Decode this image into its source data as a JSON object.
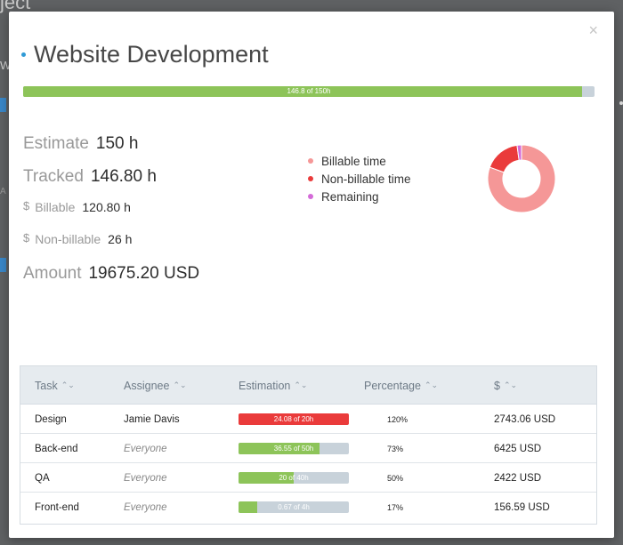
{
  "backdrop": {
    "title_fragment": "ject",
    "letter_w": "W",
    "letter_a": "A"
  },
  "modal": {
    "close_glyph": "×",
    "title": "Website Development",
    "progress": {
      "label": "146.8 of 150h",
      "fraction": 0.9787,
      "fill_color": "#8dc459",
      "track_color": "#c8d2da"
    },
    "stats": {
      "estimate": {
        "label": "Estimate",
        "value": "150 h"
      },
      "tracked": {
        "label": "Tracked",
        "value": "146.80 h"
      },
      "billable": {
        "currency": "$",
        "label": "Billable",
        "value": "120.80 h"
      },
      "non_billable": {
        "currency": "$",
        "label": "Non-billable",
        "value": "26 h"
      },
      "amount": {
        "label": "Amount",
        "value": "19675.20 USD"
      }
    },
    "legend": [
      {
        "label": "Billable time",
        "color": "#f59797"
      },
      {
        "label": "Non-billable time",
        "color": "#ea3b3b"
      },
      {
        "label": "Remaining",
        "color": "#d46bd8"
      }
    ],
    "donut": {
      "segments": [
        {
          "name": "Billable time",
          "value": 120.8,
          "color": "#f59797"
        },
        {
          "name": "Non-billable time",
          "value": 26,
          "color": "#ea3b3b"
        },
        {
          "name": "Remaining",
          "value": 3.2,
          "color": "#d46bd8"
        }
      ]
    },
    "table": {
      "headers": [
        "Task",
        "Assignee",
        "Estimation",
        "Percentage",
        "$"
      ],
      "sort_glyph": "⌃⌄",
      "rows": [
        {
          "task": "Design",
          "assignee": "Jamie Davis",
          "assignee_any": false,
          "est_label": "24.08 of 20h",
          "fraction": 1.0,
          "fill_color": "#ea3b3b",
          "percentage": "120%",
          "amount": "2743.06 USD"
        },
        {
          "task": "Back-end",
          "assignee": "Everyone",
          "assignee_any": true,
          "est_label": "36.55 of 50h",
          "fraction": 0.73,
          "fill_color": "#8dc459",
          "percentage": "73%",
          "amount": "6425 USD"
        },
        {
          "task": "QA",
          "assignee": "Everyone",
          "assignee_any": true,
          "est_label": "20 of 40h",
          "fraction": 0.5,
          "fill_color": "#8dc459",
          "percentage": "50%",
          "amount": "2422 USD"
        },
        {
          "task": "Front-end",
          "assignee": "Everyone",
          "assignee_any": true,
          "est_label": "0.67 of 4h",
          "fraction": 0.17,
          "fill_color": "#8dc459",
          "percentage": "17%",
          "amount": "156.59 USD"
        }
      ]
    }
  }
}
